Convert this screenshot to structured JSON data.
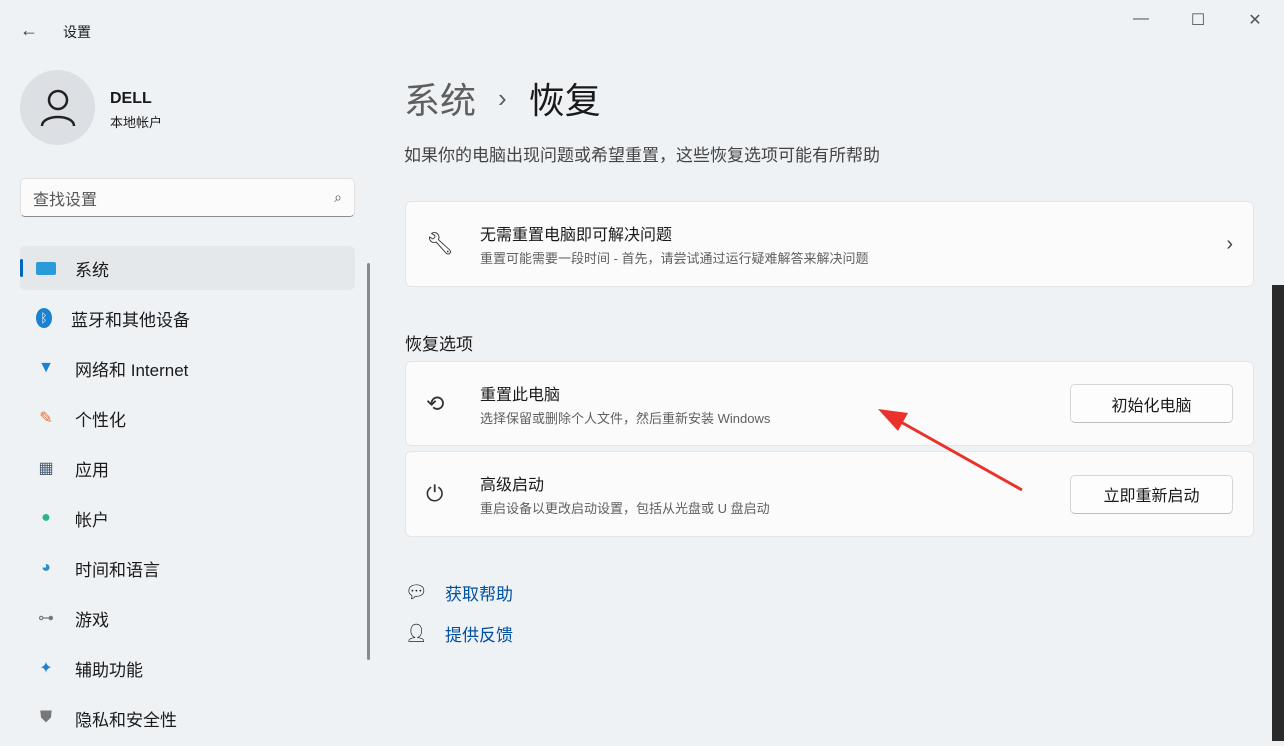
{
  "window": {
    "title": "设置"
  },
  "user": {
    "name": "DELL",
    "account_type": "本地帐户"
  },
  "search": {
    "placeholder": "查找设置"
  },
  "sidebar": {
    "items": [
      {
        "label": "系统",
        "icon": "system-icon",
        "selected": true
      },
      {
        "label": "蓝牙和其他设备",
        "icon": "bluetooth-icon"
      },
      {
        "label": "网络和 Internet",
        "icon": "wifi-icon"
      },
      {
        "label": "个性化",
        "icon": "brush-icon"
      },
      {
        "label": "应用",
        "icon": "apps-icon"
      },
      {
        "label": "帐户",
        "icon": "account-icon"
      },
      {
        "label": "时间和语言",
        "icon": "globe-clock-icon"
      },
      {
        "label": "游戏",
        "icon": "gamepad-icon"
      },
      {
        "label": "辅助功能",
        "icon": "accessibility-icon"
      },
      {
        "label": "隐私和安全性",
        "icon": "shield-icon"
      }
    ]
  },
  "breadcrumb": {
    "parent": "系统",
    "separator": "›",
    "current": "恢复"
  },
  "description": "如果你的电脑出现问题或希望重置，这些恢复选项可能有所帮助",
  "fix_card": {
    "title": "无需重置电脑即可解决问题",
    "subtitle": "重置可能需要一段时间 - 首先，请尝试通过运行疑难解答来解决问题"
  },
  "section_title": "恢复选项",
  "options": [
    {
      "title": "重置此电脑",
      "subtitle": "选择保留或删除个人文件，然后重新安装 Windows",
      "button": "初始化电脑"
    },
    {
      "title": "高级启动",
      "subtitle": "重启设备以更改启动设置，包括从光盘或 U 盘启动",
      "button": "立即重新启动"
    }
  ],
  "links": {
    "help": "获取帮助",
    "feedback": "提供反馈"
  },
  "colors": {
    "accent": "#0067c0",
    "annotation_arrow": "#e8322b"
  }
}
